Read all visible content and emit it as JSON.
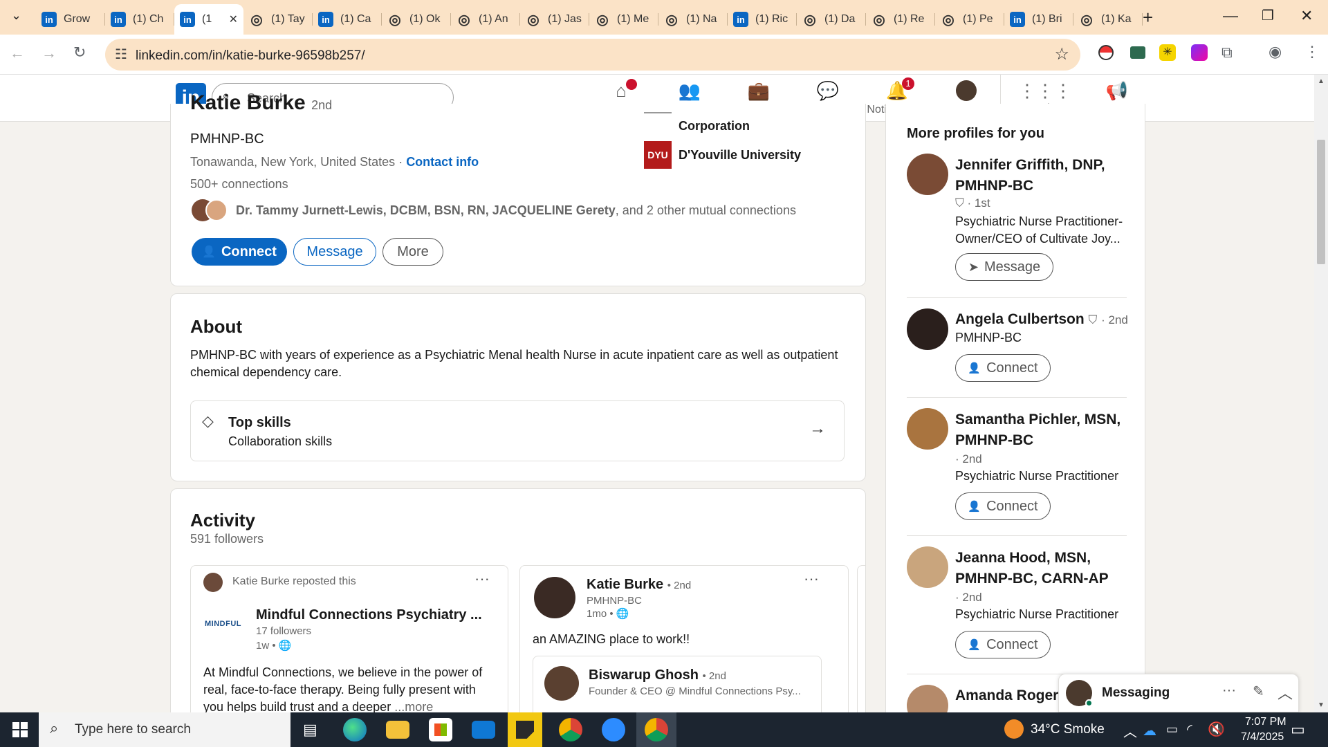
{
  "browser": {
    "tabs": [
      {
        "label": "Grow",
        "type": "li"
      },
      {
        "label": "(1) Ch",
        "type": "li"
      },
      {
        "label": "(1",
        "type": "li",
        "active": true
      },
      {
        "label": "(1) Tay",
        "type": "ring"
      },
      {
        "label": "(1) Ca",
        "type": "li"
      },
      {
        "label": "(1) Ok",
        "type": "ring"
      },
      {
        "label": "(1) An",
        "type": "ring"
      },
      {
        "label": "(1) Jas",
        "type": "ring"
      },
      {
        "label": "(1) Me",
        "type": "ring"
      },
      {
        "label": "(1) Na",
        "type": "ring"
      },
      {
        "label": "(1) Ric",
        "type": "li"
      },
      {
        "label": "(1) Da",
        "type": "ring"
      },
      {
        "label": "(1) Re",
        "type": "ring"
      },
      {
        "label": "(1) Pe",
        "type": "ring"
      },
      {
        "label": "(1) Bri",
        "type": "li"
      },
      {
        "label": "(1) Ka",
        "type": "ring"
      }
    ],
    "url": "linkedin.com/in/katie-burke-96598b257/"
  },
  "nav": {
    "search_placeholder": "Search",
    "items": [
      {
        "label": "Home",
        "icon": "home-icon"
      },
      {
        "label": "My Network",
        "icon": "network-icon"
      },
      {
        "label": "Jobs",
        "icon": "briefcase-icon"
      },
      {
        "label": "Messaging",
        "icon": "chat-icon"
      },
      {
        "label": "Notifications",
        "icon": "bell-icon",
        "badge": "1"
      },
      {
        "label": "Me",
        "icon": "avatar"
      },
      {
        "label": "For Business",
        "icon": "grid-icon"
      },
      {
        "label": "Advertise",
        "icon": "megaphone-icon"
      }
    ]
  },
  "profile": {
    "name": "Katie Burke",
    "degree": "2nd",
    "headline": "PMHNP-BC",
    "location": "Tonawanda, New York, United States",
    "contact_info": "Contact info",
    "connections": "500+ connections",
    "mutual_names": "Dr. Tammy Jurnett-Lewis, DCBM, BSN, RN, JACQUELINE Gerety",
    "mutual_rest": ", and 2 other mutual connections",
    "experience_org": "Corporation",
    "education_logo": "DYU",
    "education": "D'Youville University",
    "buttons": {
      "connect": "Connect",
      "message": "Message",
      "more": "More"
    }
  },
  "about": {
    "heading": "About",
    "text": "PMHNP-BC with years of experience as a Psychiatric Menal health Nurse in acute inpatient care as well as outpatient chemical dependency care.",
    "top_skills_title": "Top skills",
    "top_skills_value": "Collaboration skills"
  },
  "activity": {
    "heading": "Activity",
    "followers": "591 followers",
    "post1": {
      "repost_line": "Katie Burke reposted this",
      "org_logo": "MINDFUL",
      "org_name": "Mindful Connections Psychiatry ...",
      "org_followers": "17 followers",
      "time": "1w •",
      "text": "At Mindful Connections, we believe in the power of real, face-to-face therapy. Being fully present with you helps build trust and a deeper",
      "more": "...more"
    },
    "post2": {
      "author": "Katie Burke",
      "degree": "• 2nd",
      "headline": "PMHNP-BC",
      "time": "1mo •",
      "text": "an AMAZING place to work!!",
      "shared_author": "Biswarup Ghosh",
      "shared_degree": "• 2nd",
      "shared_headline": "Founder & CEO @ Mindful Connections Psy..."
    }
  },
  "sidebar": {
    "heading": "More profiles for you",
    "profiles": [
      {
        "name": "Jennifer Griffith, DNP,",
        "name2": "PMHNP-BC",
        "degree": "1st",
        "desc": "Psychiatric Nurse Practitioner-",
        "desc2": "Owner/CEO of Cultivate Joy...",
        "action": "Message"
      },
      {
        "name": "Angela Culbertson",
        "degree": "2nd",
        "desc": "PMHNP-BC",
        "action": "Connect"
      },
      {
        "name": "Samantha Pichler, MSN,",
        "name2": "PMHNP-BC",
        "degree": "· 2nd",
        "desc": "Psychiatric Nurse Practitioner",
        "action": "Connect"
      },
      {
        "name": "Jeanna Hood, MSN,",
        "name2": "PMHNP-BC, CARN-AP",
        "degree": "· 2nd",
        "desc": "Psychiatric Nurse Practitioner",
        "action": "Connect"
      },
      {
        "name": "Amanda Rogers,"
      }
    ]
  },
  "messaging": {
    "title": "Messaging"
  },
  "taskbar": {
    "search_placeholder": "Type here to search",
    "weather": "34°C  Smoke",
    "time": "7:07 PM",
    "date": "7/4/2025"
  },
  "colors": {
    "linkedin_blue": "#0a66c2",
    "tabstrip": "#fbe3c7",
    "page_bg": "#f4f2ee"
  }
}
